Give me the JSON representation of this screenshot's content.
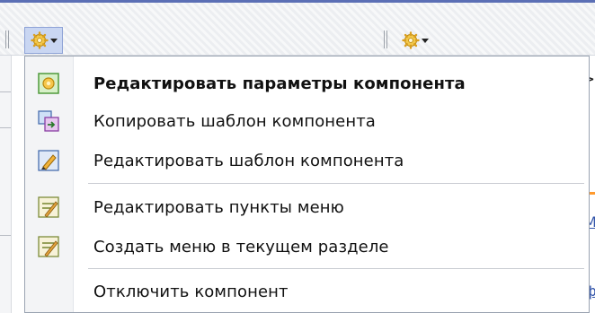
{
  "toolbar": {
    "buttons": [
      {
        "icon": "gear-icon",
        "state": "active"
      },
      {
        "icon": "gear-icon",
        "state": "normal"
      }
    ]
  },
  "menu": {
    "items": [
      {
        "label": "Редактировать параметры компонента",
        "icon": "component-settings-icon",
        "bold": true
      },
      {
        "label": "Копировать шаблон компонента",
        "icon": "copy-template-icon"
      },
      {
        "label": "Редактировать шаблон компонента",
        "icon": "edit-template-icon"
      },
      {
        "label": "Редактировать пункты меню",
        "icon": "edit-menu-items-icon"
      },
      {
        "label": "Создать меню в текущем разделе",
        "icon": "create-menu-icon"
      },
      {
        "label": "Отключить компонент",
        "icon": ""
      }
    ]
  },
  "side": {
    "arrow": ">",
    "text_m": "M",
    "text_f": "ф"
  },
  "colors": {
    "accent_blue": "#5b6fb5",
    "active_button": "#c9d6f2",
    "link": "#3355aa",
    "orange": "#ff9a2e"
  }
}
